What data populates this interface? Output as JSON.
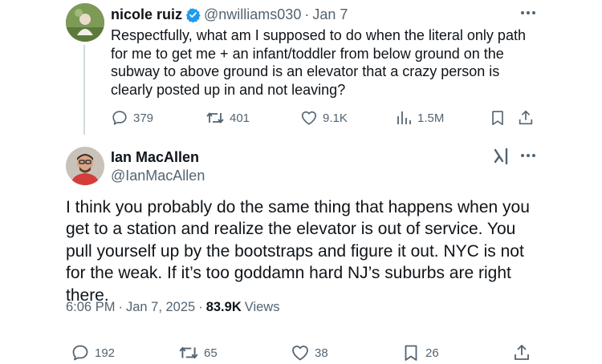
{
  "parent": {
    "name": "nicole ruiz",
    "handle": "@nwilliams030",
    "dot": "·",
    "date": "Jan 7",
    "text": "Respectfully, what am I supposed to do when the literal only path for me to get me + an infant/toddler from below ground on the subway to above ground is an elevator that a crazy person is clearly posted up in and not leaving?",
    "replies": "379",
    "reposts": "401",
    "likes": "9.1K",
    "views": "1.5M"
  },
  "main": {
    "name": "Ian MacAllen",
    "handle": "@IanMacAllen",
    "text": "I think you probably do the same thing that happens when you get to a station and realize the elevator is out of service. You pull yourself up by the bootstraps and figure it out. NYC is not for the weak. If it’s too goddamn hard NJ’s suburbs are right there.",
    "time": "6:06 PM",
    "sep1": "·",
    "date": "Jan 7, 2025",
    "sep2": "·",
    "views_count": "83.9K",
    "views_label": "Views",
    "replies": "192",
    "reposts": "65",
    "likes": "38",
    "bookmarks": "26"
  },
  "colors": {
    "verified": "#1d9bf0",
    "text": "#0f1419",
    "muted": "#536471",
    "thread_line": "#cfd9de"
  },
  "icons": [
    "verified-badge-icon",
    "more-icon",
    "grok-icon",
    "reply-icon",
    "repost-icon",
    "like-icon",
    "views-icon",
    "bookmark-icon",
    "share-icon"
  ]
}
